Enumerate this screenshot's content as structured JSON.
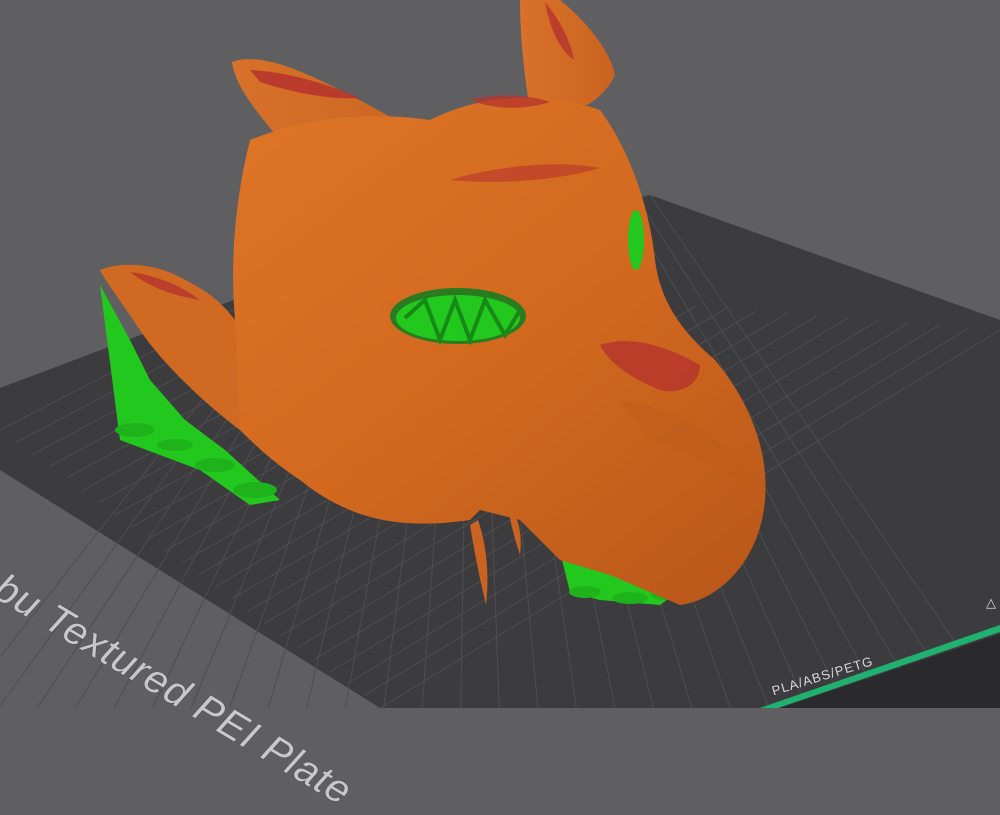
{
  "viewport": {
    "background_color": "#5f5f62",
    "plate_color": "#3c3c3f",
    "grid_color": "#56565a",
    "model_color": "#d2691e",
    "overhang_color": "#b5332e",
    "support_color": "#22c81e",
    "plate_edge_color": "#20b070"
  },
  "plate": {
    "label": "mbu Textured PEI Plate",
    "filament_label": "PLA/ABS/PETG",
    "corner_icon": "warning-triangle-icon"
  }
}
